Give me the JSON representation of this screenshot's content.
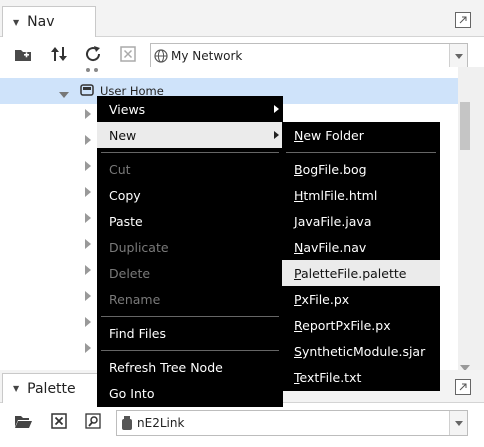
{
  "nav": {
    "title": "Nav",
    "network_select": {
      "value": "My Network"
    },
    "tree": {
      "user_home_label": "User Home",
      "collapsed_rows": 10
    }
  },
  "context_menu": {
    "items": [
      {
        "label": "Views",
        "enabled": true,
        "submenu": true
      },
      {
        "label": "New",
        "enabled": true,
        "submenu": true,
        "highlighted": true
      },
      {
        "label": "Cut",
        "enabled": false
      },
      {
        "label": "Copy",
        "enabled": true
      },
      {
        "label": "Paste",
        "enabled": true
      },
      {
        "label": "Duplicate",
        "enabled": false
      },
      {
        "label": "Delete",
        "enabled": false
      },
      {
        "label": "Rename",
        "enabled": false
      },
      {
        "label": "Find Files",
        "enabled": true
      },
      {
        "label": "Refresh Tree Node",
        "enabled": true
      },
      {
        "label": "Go Into",
        "enabled": true
      }
    ]
  },
  "new_submenu": {
    "items": [
      {
        "label": "New Folder",
        "mnemonic": "N"
      },
      {
        "label": "BogFile.bog",
        "mnemonic": "B"
      },
      {
        "label": "HtmlFile.html",
        "mnemonic": "H"
      },
      {
        "label": "JavaFile.java",
        "mnemonic": "J"
      },
      {
        "label": "NavFile.nav",
        "mnemonic": "N"
      },
      {
        "label": "PaletteFile.palette",
        "mnemonic": "P",
        "highlighted": true
      },
      {
        "label": "PxFile.px",
        "mnemonic": "P"
      },
      {
        "label": "ReportPxFile.px",
        "mnemonic": "R"
      },
      {
        "label": "SyntheticModule.sjar",
        "mnemonic": "S"
      },
      {
        "label": "TextFile.txt",
        "mnemonic": "T"
      }
    ]
  },
  "palette": {
    "title": "Palette",
    "module_select": {
      "value": "nE2Link"
    }
  },
  "colors": {
    "menu_bg": "#000000",
    "menu_highlight": "#ebebeb",
    "selection": "#cfe3fa",
    "disabled_text": "#7a7a7a"
  }
}
